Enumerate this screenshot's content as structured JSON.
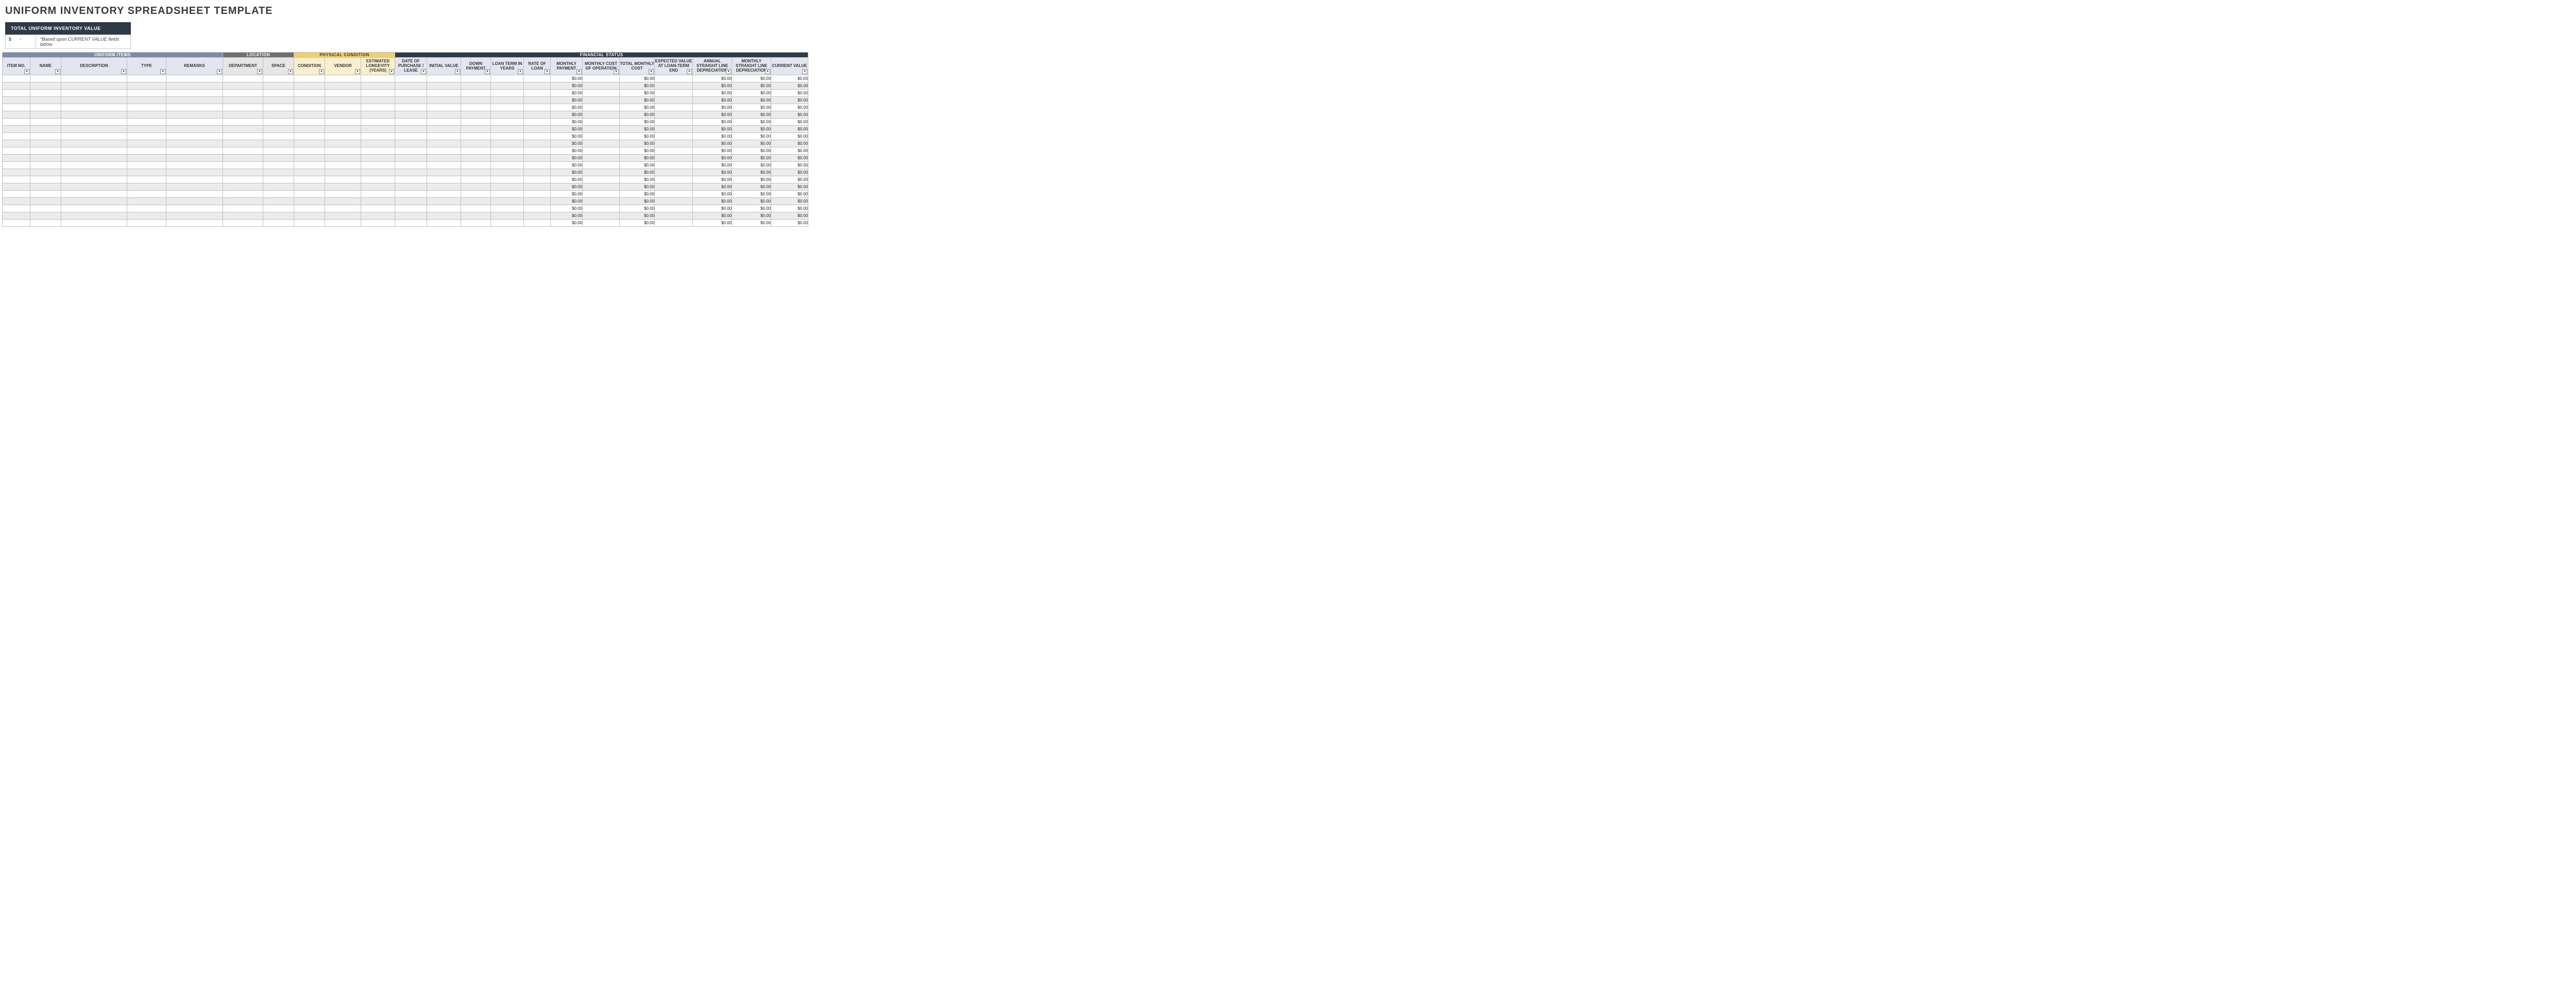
{
  "title": "UNIFORM INVENTORY SPREADSHEET TEMPLATE",
  "summary": {
    "label": "TOTAL UNIFORM INVENTORY VALUE",
    "value": "-",
    "note": "*Based upon CURRENT VALUE fields below"
  },
  "sections": {
    "uniform": "UNIFORM ITEMS",
    "location": "LOCATION",
    "physical": "PHYSICAL CONDITION",
    "financial": "FINANCIAL STATUS"
  },
  "columns": {
    "itemno": "ITEM NO.",
    "name": "NAME",
    "description": "DESCRIPTION",
    "type": "TYPE",
    "remarks": "REMARKS",
    "department": "DEPARTMENT",
    "space": "SPACE",
    "condition": "CONDITION",
    "vendor": "VENDOR",
    "est_longevity": "ESTIMATED LONGEVITY (YEARS)",
    "date_purchase": "DATE OF PURCHASE / LEASE",
    "initial_value": "INITIAL VALUE",
    "down_payment": "DOWN PAYMENT",
    "loan_term": "LOAN TERM IN YEARS",
    "rate_of_loan": "RATE OF LOAN",
    "monthly_payment": "MONTHLY PAYMENT",
    "monthly_cost_op": "MONTHLY COST OF OPERATION",
    "total_monthly_cost": "TOTAL MONTHLY COST",
    "expected_value": "EXPECTED VALUE AT LOAN-TERM END",
    "annual_depr": "ANNUAL STRAIGHT LINE DEPRECIATION",
    "monthly_depr": "MONTHLY STRAIGHT LINE DEPRECIATION",
    "current_value": "CURRENT VALUE"
  },
  "default_money": "$0.00",
  "row_count": 21
}
